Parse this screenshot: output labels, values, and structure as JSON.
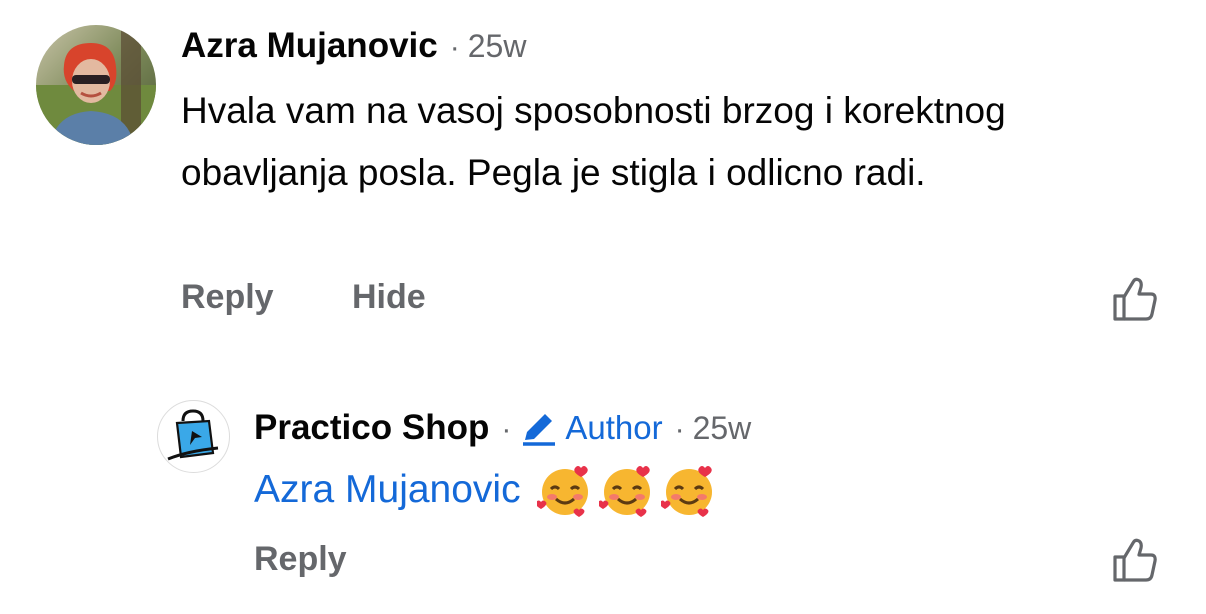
{
  "comment": {
    "author": "Azra Mujanovic",
    "separator": "·",
    "time": "25w",
    "text": "Hvala vam na vasoj sposobnosti brzog i korektnog obavljanja posla. Pegla je stigla i odlicno radi.",
    "actions": {
      "reply": "Reply",
      "hide": "Hide"
    },
    "like_icon": "thumbs-up-icon"
  },
  "reply": {
    "author": "Practico Shop",
    "separator": "·",
    "badge_icon": "pencil-icon",
    "badge_label": "Author",
    "separator2": "·",
    "time": "25w",
    "mention": "Azra Mujanovic",
    "emojis": [
      "smiling-face-with-hearts-icon",
      "smiling-face-with-hearts-icon",
      "smiling-face-with-hearts-icon"
    ],
    "actions": {
      "reply": "Reply"
    },
    "like_icon": "thumbs-up-icon"
  },
  "colors": {
    "text": "#050505",
    "secondary": "#65676b",
    "accent": "#1469d8"
  }
}
